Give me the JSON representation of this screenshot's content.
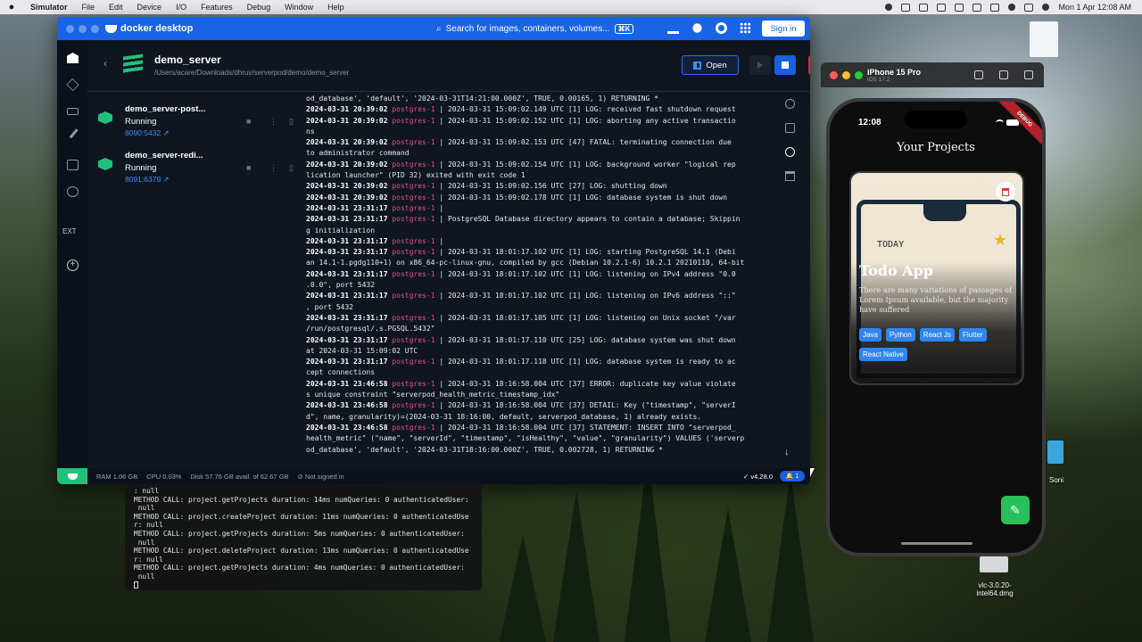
{
  "menubar": {
    "items": [
      "Simulator",
      "File",
      "Edit",
      "Device",
      "I/O",
      "Features",
      "Debug",
      "Window",
      "Help"
    ],
    "clock": "Mon 1 Apr  12:08 AM"
  },
  "docker": {
    "app_title": "docker desktop",
    "search_placeholder": "Search for images, containers, volumes...",
    "search_shortcut": "⌘K",
    "signin_label": "Sign in",
    "stack_name": "demo_server",
    "stack_path": "/Users/acare/Downloads/dhruv/serverpod/demo/demo_server",
    "open_label": "Open",
    "containers": [
      {
        "name": "demo_server-post...",
        "status": "Running",
        "port": "8090:5432"
      },
      {
        "name": "demo_server-redi...",
        "status": "Running",
        "port": "8091:6379"
      }
    ],
    "logs": [
      {
        "ts": "",
        "svc": "",
        "msg": "od_database', 'default', '2024-03-31T14:21:00.000Z', TRUE, 0.00165, 1) RETURNING *"
      },
      {
        "ts": "2024-03-31 20:39:02",
        "svc": "postgres-1",
        "msg": " | 2024-03-31 15:09:02.149 UTC [1] LOG:  received fast shutdown request"
      },
      {
        "ts": "2024-03-31 20:39:02",
        "svc": "postgres-1",
        "msg": " | 2024-03-31 15:09:02.152 UTC [1] LOG:  aborting any active transactio"
      },
      {
        "ts": "",
        "svc": "",
        "msg": "ns"
      },
      {
        "ts": "2024-03-31 20:39:02",
        "svc": "postgres-1",
        "msg": " | 2024-03-31 15:09:02.153 UTC [47] FATAL:  terminating connection due"
      },
      {
        "ts": "",
        "svc": "",
        "msg": " to administrator command"
      },
      {
        "ts": "2024-03-31 20:39:02",
        "svc": "postgres-1",
        "msg": " | 2024-03-31 15:09:02.154 UTC [1] LOG:  background worker \"logical rep"
      },
      {
        "ts": "",
        "svc": "",
        "msg": "lication launcher\" (PID 32) exited with exit code 1"
      },
      {
        "ts": "2024-03-31 20:39:02",
        "svc": "postgres-1",
        "msg": " | 2024-03-31 15:09:02.156 UTC [27] LOG:  shutting down"
      },
      {
        "ts": "2024-03-31 20:39:02",
        "svc": "postgres-1",
        "msg": " | 2024-03-31 15:09:02.178 UTC [1] LOG:  database system is shut down"
      },
      {
        "ts": "2024-03-31 23:31:17",
        "svc": "postgres-1",
        "msg": " |"
      },
      {
        "ts": "2024-03-31 23:31:17",
        "svc": "postgres-1",
        "msg": " | PostgreSQL Database directory appears to contain a database; Skippin"
      },
      {
        "ts": "",
        "svc": "",
        "msg": "g initialization"
      },
      {
        "ts": "2024-03-31 23:31:17",
        "svc": "postgres-1",
        "msg": " |"
      },
      {
        "ts": "2024-03-31 23:31:17",
        "svc": "postgres-1",
        "msg": " | 2024-03-31 18:01:17.102 UTC [1] LOG:  starting PostgreSQL 14.1 (Debi"
      },
      {
        "ts": "",
        "svc": "",
        "msg": "an 14.1-1.pgdg110+1) on x86_64-pc-linux-gnu, compiled by gcc (Debian 10.2.1-6) 10.2.1 20210110, 64-bit"
      },
      {
        "ts": "2024-03-31 23:31:17",
        "svc": "postgres-1",
        "msg": " | 2024-03-31 18:01:17.102 UTC [1] LOG:  listening on IPv4 address \"0.0"
      },
      {
        "ts": "",
        "svc": "",
        "msg": ".0.0\", port 5432"
      },
      {
        "ts": "2024-03-31 23:31:17",
        "svc": "postgres-1",
        "msg": " | 2024-03-31 18:01:17.102 UTC [1] LOG:  listening on IPv6 address \"::\""
      },
      {
        "ts": "",
        "svc": "",
        "msg": ", port 5432"
      },
      {
        "ts": "2024-03-31 23:31:17",
        "svc": "postgres-1",
        "msg": " | 2024-03-31 18:01:17.105 UTC [1] LOG:  listening on Unix socket \"/var"
      },
      {
        "ts": "",
        "svc": "",
        "msg": "/run/postgresql/.s.PGSQL.5432\""
      },
      {
        "ts": "2024-03-31 23:31:17",
        "svc": "postgres-1",
        "msg": " | 2024-03-31 18:01:17.110 UTC [25] LOG:  database system was shut down"
      },
      {
        "ts": "",
        "svc": "",
        "msg": " at 2024-03-31 15:09:02 UTC"
      },
      {
        "ts": "2024-03-31 23:31:17",
        "svc": "postgres-1",
        "msg": " | 2024-03-31 18:01:17.118 UTC [1] LOG:  database system is ready to ac"
      },
      {
        "ts": "",
        "svc": "",
        "msg": "cept connections"
      },
      {
        "ts": "2024-03-31 23:46:58",
        "svc": "postgres-1",
        "msg": " | 2024-03-31 18:16:58.004 UTC [37] ERROR:  duplicate key value violate"
      },
      {
        "ts": "",
        "svc": "",
        "msg": "s unique constraint \"serverpod_health_metric_timestamp_idx\""
      },
      {
        "ts": "2024-03-31 23:46:58",
        "svc": "postgres-1",
        "msg": " | 2024-03-31 18:16:58.004 UTC [37] DETAIL:  Key (\"timestamp\", \"serverI"
      },
      {
        "ts": "",
        "svc": "",
        "msg": "d\", name, granularity)=(2024-03-31 18:16:00, default, serverpod_database, 1) already exists."
      },
      {
        "ts": "2024-03-31 23:46:58",
        "svc": "postgres-1",
        "msg": " | 2024-03-31 18:16:58.004 UTC [37] STATEMENT:  INSERT INTO \"serverpod_"
      },
      {
        "ts": "",
        "svc": "",
        "msg": "health_metric\" (\"name\", \"serverId\", \"timestamp\", \"isHealthy\", \"value\", \"granularity\") VALUES ('serverp"
      },
      {
        "ts": "",
        "svc": "",
        "msg": "od_database', 'default', '2024-03-31T18:16:00.000Z', TRUE, 0.002728, 1) RETURNING *"
      }
    ],
    "status": {
      "ram": "RAM 1.06 GB",
      "cpu": "CPU 0.03%",
      "disk": "Disk 57.76 GB avail. of 62.67 GB",
      "signin": "Not signed in",
      "version": "v4.28.0",
      "notifications": "1"
    }
  },
  "terminal": {
    "lines": [
      ": null",
      "METHOD CALL: project.getProjects duration: 14ms numQueries: 0 authenticatedUser:",
      " null",
      "METHOD CALL: project.createProject duration: 11ms numQueries: 0 authenticatedUse",
      "r: null",
      "METHOD CALL: project.getProjects duration: 5ms numQueries: 0 authenticatedUser:",
      " null",
      "METHOD CALL: project.deleteProject duration: 13ms numQueries: 0 authenticatedUse",
      "r: null",
      "METHOD CALL: project.getProjects duration: 4ms numQueries: 0 authenticatedUser:",
      " null"
    ]
  },
  "desktop": {
    "file_top_label": "Soni",
    "file_bottom_label": "vlc-3.0.20-intel64.dmg"
  },
  "simulator": {
    "device": "iPhone 15 Pro",
    "os": "iOS 17.2",
    "phone": {
      "time": "12:08",
      "debug_banner": "DEBUG",
      "page_title": "Your Projects",
      "project": {
        "image_text_today": "TODAY",
        "title": "Todo App",
        "description": "There are many variations of passages of Lorem Ipsum available, but the majority have suffered",
        "tags": [
          "Java",
          "Python",
          "React Js",
          "Flutter",
          "React Native"
        ]
      },
      "fab_icon": "✎"
    }
  },
  "colors": {
    "docker_blue": "#1863e6",
    "running_green": "#21c17a",
    "log_service": "#e24c8b",
    "tag_blue": "#2f86ee",
    "fab_green": "#28c05a"
  }
}
